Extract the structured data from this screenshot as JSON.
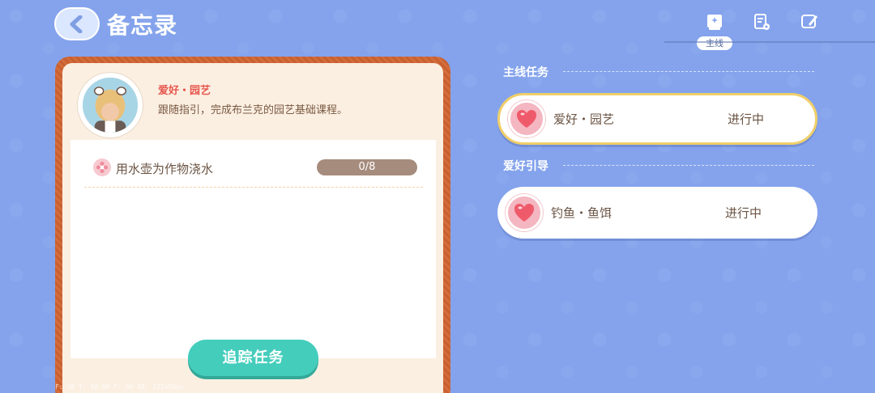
{
  "header": {
    "title": "备忘录",
    "main_tab_label": "主线"
  },
  "detail": {
    "tag": "爱好・园艺",
    "description": "跟随指引，完成布兰克的园艺基础课程。",
    "task": {
      "label": "用水壶为作物浇水",
      "progress_text": "0/8",
      "progress_fraction": 0
    },
    "track_button": "追踪任务"
  },
  "list": {
    "sections": [
      {
        "title": "主线任务",
        "quests": [
          {
            "name": "爱好・园艺",
            "status": "进行中",
            "selected": true
          }
        ]
      },
      {
        "title": "爱好引导",
        "quests": [
          {
            "name": "钓鱼・鱼饵",
            "status": "进行中",
            "selected": false
          }
        ]
      }
    ]
  },
  "debug": {
    "text": "F: 30   T: 58.90   F: 36   IB: 222x56px"
  },
  "icons": {
    "back": "chevron-left-icon",
    "main_quest": "main-quest-book-icon",
    "list_settings": "clipboard-gear-icon",
    "edit": "pencil-icon",
    "quest": "heart-icon"
  },
  "colors": {
    "background": "#84a3ec",
    "card_border": "#d36d3b",
    "accent_teal": "#45cdbc",
    "selected_border": "#f0cf6a",
    "tag_red": "#e8574e"
  }
}
